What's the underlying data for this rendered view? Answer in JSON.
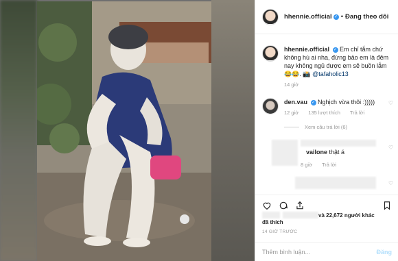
{
  "header": {
    "username": "hhennie.official",
    "follow_separator": "•",
    "follow_label": "Đang theo dõi"
  },
  "caption": {
    "username": "hhennie.official",
    "text": "Em chỉ tắm chứ không hù ai nha, đừng bảo em là đêm nay không ngủ được em sẽ buồn lắm 😂😂. 📸",
    "mention": "@tafaholic13",
    "time": "14 giờ"
  },
  "comments": [
    {
      "username": "den.vau",
      "text": "Nghịch vừa thôi :)))))",
      "time": "12 giờ",
      "likes": "135 lượt thích",
      "reply": "Trả lời",
      "view_replies": "Xem câu trả lời (6)"
    },
    {
      "username": "vailone",
      "text": "thật á",
      "time": "8 giờ",
      "reply": "Trả lời"
    }
  ],
  "actions": {
    "likes_text": "và 22,672 người khác",
    "liked_label": "đã thích",
    "post_time": "14 GIỜ TRƯỚC"
  },
  "comment_box": {
    "placeholder": "Thêm bình luận...",
    "post_label": "Đăng"
  },
  "colors": {
    "link_blue": "#3897f0",
    "post_disabled": "#b2dffc"
  },
  "icons": [
    "heart-icon",
    "comment-icon",
    "share-icon",
    "bookmark-icon",
    "verified-icon"
  ]
}
